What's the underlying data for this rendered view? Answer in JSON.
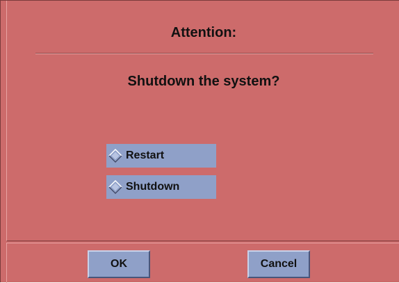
{
  "dialog": {
    "title": "Attention:",
    "question": "Shutdown the system?",
    "options": [
      {
        "label": "Restart",
        "selected": false
      },
      {
        "label": "Shutdown",
        "selected": false
      }
    ],
    "buttons": {
      "ok_label": "OK",
      "cancel_label": "Cancel"
    }
  },
  "colors": {
    "dialog_background": "#cd6b6b",
    "control_background": "#8fa0c8",
    "text": "#111111"
  },
  "icons": {
    "radio": "diamond-radio-icon"
  }
}
